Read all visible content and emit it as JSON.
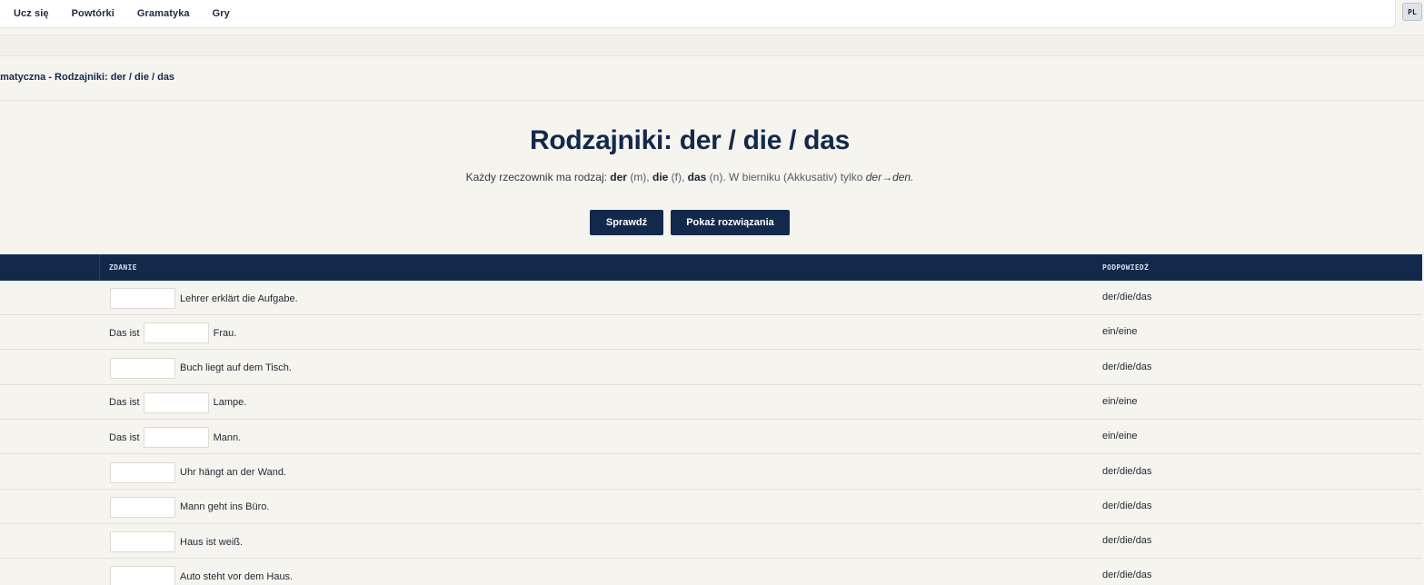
{
  "nav": {
    "items": [
      "Ucz się",
      "Powtórki",
      "Gramatyka",
      "Gry"
    ],
    "lang": "PL"
  },
  "breadcrumb": "amatyczna - Rodzajniki: der / die / das",
  "title": "Rodzajniki: der / die / das",
  "subtitle": {
    "p1": "Każdy rzeczownik ma rodzaj: ",
    "der": "der",
    "m": " (m), ",
    "die": "die",
    "f": " (f), ",
    "das": "das",
    "n": " (n). W bierniku (Akkusativ) tylko ",
    "rule": "der→den."
  },
  "buttons": {
    "check": "Sprawdź",
    "show": "Pokaż rozwiązania"
  },
  "table": {
    "headers": {
      "sentence": "ZDANIE",
      "hint": "PODPOWIEDŹ"
    },
    "rows": [
      {
        "pre": "",
        "post": "Lehrer erklärt die Aufgabe.",
        "hint": "der/die/das"
      },
      {
        "pre": "Das ist",
        "post": "Frau.",
        "hint": "ein/eine"
      },
      {
        "pre": "",
        "post": "Buch liegt auf dem Tisch.",
        "hint": "der/die/das"
      },
      {
        "pre": "Das ist",
        "post": "Lampe.",
        "hint": "ein/eine"
      },
      {
        "pre": "Das ist",
        "post": "Mann.",
        "hint": "ein/eine"
      },
      {
        "pre": "",
        "post": "Uhr hängt an der Wand.",
        "hint": "der/die/das"
      },
      {
        "pre": "",
        "post": "Mann geht ins Büro.",
        "hint": "der/die/das"
      },
      {
        "pre": "",
        "post": "Haus ist weiß.",
        "hint": "der/die/das"
      },
      {
        "pre": "",
        "post": "Auto steht vor dem Haus.",
        "hint": "der/die/das"
      }
    ]
  }
}
